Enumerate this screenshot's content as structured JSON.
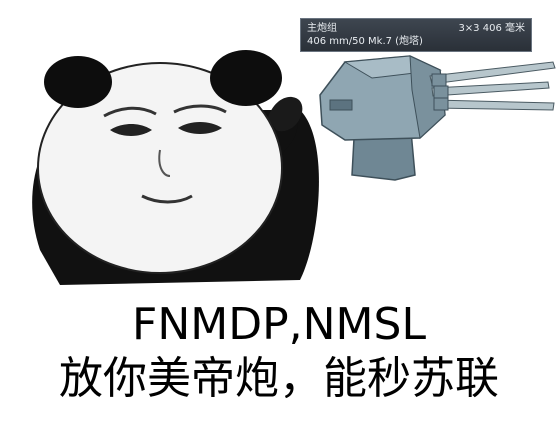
{
  "tooltip": {
    "title": "主炮组",
    "mount": "3×3 406 毫米",
    "gun": "406 mm/50 Mk.7 (炮塔)"
  },
  "caption": {
    "line1": "FNMDP,NMSL",
    "line2": "放你美帝炮，能秒苏联"
  },
  "colors": {
    "turret": "#8fa6b2",
    "turret_dark": "#5c7380",
    "tooltip_bg": "#343b44"
  }
}
